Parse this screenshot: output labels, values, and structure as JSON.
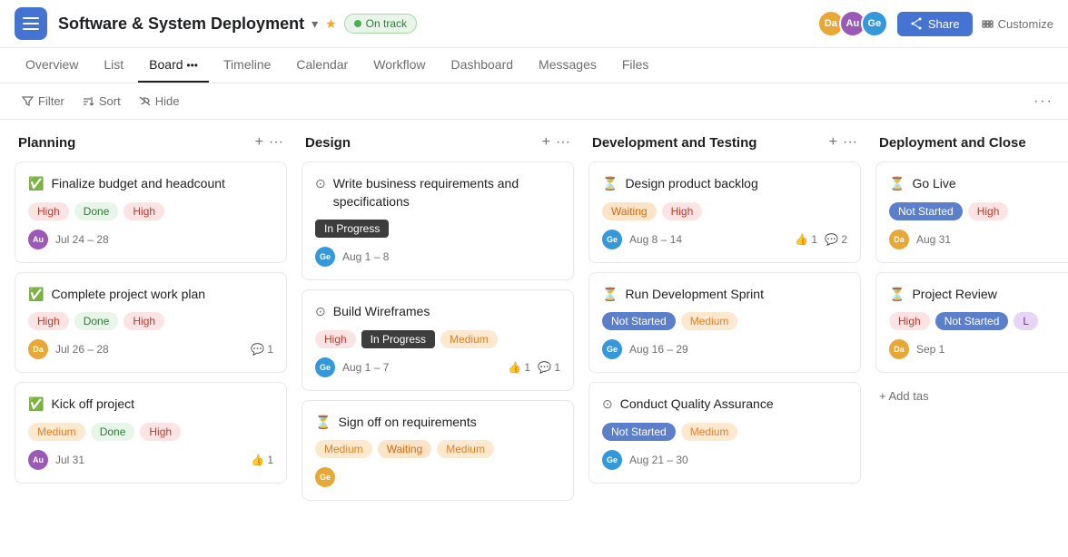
{
  "app": {
    "menu_label": "Menu",
    "project_title": "Software & System Deployment",
    "status": "On track",
    "share_label": "Share",
    "customize_label": "Customize"
  },
  "nav": {
    "items": [
      {
        "label": "Overview",
        "active": false
      },
      {
        "label": "List",
        "active": false
      },
      {
        "label": "Board",
        "active": true
      },
      {
        "label": "Timeline",
        "active": false
      },
      {
        "label": "Calendar",
        "active": false
      },
      {
        "label": "Workflow",
        "active": false
      },
      {
        "label": "Dashboard",
        "active": false
      },
      {
        "label": "Messages",
        "active": false
      },
      {
        "label": "Files",
        "active": false
      }
    ]
  },
  "toolbar": {
    "filter_label": "Filter",
    "sort_label": "Sort",
    "hide_label": "Hide"
  },
  "avatars": [
    {
      "initials": "Da",
      "color": "#e8a838"
    },
    {
      "initials": "Au",
      "color": "#9b59b6"
    },
    {
      "initials": "Ge",
      "color": "#3498db"
    }
  ],
  "columns": [
    {
      "id": "planning",
      "title": "Planning",
      "cards": [
        {
          "id": "card-1",
          "icon": "green-check",
          "title": "Finalize budget and headcount",
          "tags": [
            {
              "label": "High",
              "type": "high"
            },
            {
              "label": "Done",
              "type": "done"
            },
            {
              "label": "High",
              "type": "high"
            }
          ],
          "avatar_initials": "Au",
          "avatar_color": "#9b59b6",
          "date": "Jul 24 – 28",
          "likes": null,
          "comments": null
        },
        {
          "id": "card-2",
          "icon": "green-check",
          "title": "Complete project work plan",
          "tags": [
            {
              "label": "High",
              "type": "high"
            },
            {
              "label": "Done",
              "type": "done"
            },
            {
              "label": "High",
              "type": "high"
            }
          ],
          "avatar_initials": "Da",
          "avatar_color": "#e8a838",
          "date": "Jul 26 – 28",
          "likes": null,
          "comments": "1"
        },
        {
          "id": "card-3",
          "icon": "green-check",
          "title": "Kick off project",
          "tags": [
            {
              "label": "Medium",
              "type": "medium"
            },
            {
              "label": "Done",
              "type": "done"
            },
            {
              "label": "High",
              "type": "high"
            }
          ],
          "avatar_initials": "Au",
          "avatar_color": "#9b59b6",
          "date": "Jul 31",
          "likes": "1",
          "comments": null
        }
      ]
    },
    {
      "id": "design",
      "title": "Design",
      "cards": [
        {
          "id": "card-4",
          "icon": "circle-check",
          "title": "Write business requirements and specifications",
          "tags": [
            {
              "label": "In Progress",
              "type": "in-progress"
            }
          ],
          "avatar_initials": "Ge",
          "avatar_color": "#3498db",
          "date": "Aug 1 – 8",
          "likes": null,
          "comments": null
        },
        {
          "id": "card-5",
          "icon": "circle-check",
          "title": "Build Wireframes",
          "tags": [
            {
              "label": "High",
              "type": "high"
            },
            {
              "label": "In Progress",
              "type": "in-progress"
            },
            {
              "label": "Medium",
              "type": "medium"
            }
          ],
          "avatar_initials": "Ge",
          "avatar_color": "#3498db",
          "date": "Aug 1 – 7",
          "likes": "1",
          "comments": "1"
        },
        {
          "id": "card-6",
          "icon": "hourglass",
          "title": "Sign off on requirements",
          "tags": [
            {
              "label": "Medium",
              "type": "medium"
            },
            {
              "label": "Waiting",
              "type": "waiting"
            },
            {
              "label": "Medium",
              "type": "medium"
            }
          ],
          "avatar_initials": "Ge",
          "avatar_color": "#e8a838",
          "date": null,
          "likes": null,
          "comments": null
        }
      ]
    },
    {
      "id": "dev-testing",
      "title": "Development and Testing",
      "cards": [
        {
          "id": "card-7",
          "icon": "hourglass",
          "title": "Design product backlog",
          "tags": [
            {
              "label": "Waiting",
              "type": "waiting"
            },
            {
              "label": "High",
              "type": "high"
            }
          ],
          "avatar_initials": "Ge",
          "avatar_color": "#3498db",
          "date": "Aug 8 – 14",
          "likes": "1",
          "comments": "2"
        },
        {
          "id": "card-8",
          "icon": "hourglass",
          "title": "Run Development Sprint",
          "tags": [
            {
              "label": "Not Started",
              "type": "not-started"
            },
            {
              "label": "Medium",
              "type": "medium"
            }
          ],
          "avatar_initials": "Ge",
          "avatar_color": "#3498db",
          "date": "Aug 16 – 29",
          "likes": null,
          "comments": null
        },
        {
          "id": "card-9",
          "icon": "circle-check",
          "title": "Conduct Quality Assurance",
          "tags": [
            {
              "label": "Not Started",
              "type": "not-started"
            },
            {
              "label": "Medium",
              "type": "medium"
            }
          ],
          "avatar_initials": "Ge",
          "avatar_color": "#3498db",
          "date": "Aug 21 – 30",
          "likes": null,
          "comments": null
        }
      ]
    },
    {
      "id": "deployment",
      "title": "Deployment and Close",
      "cards": [
        {
          "id": "card-10",
          "icon": "hourglass",
          "title": "Go Live",
          "tags": [
            {
              "label": "Not Started",
              "type": "not-started"
            },
            {
              "label": "High",
              "type": "high"
            }
          ],
          "avatar_initials": "Da",
          "avatar_color": "#e8a838",
          "date": "Aug 31",
          "likes": null,
          "comments": null
        },
        {
          "id": "card-11",
          "icon": "hourglass",
          "title": "Project Review",
          "tags": [
            {
              "label": "High",
              "type": "high"
            },
            {
              "label": "Not Started",
              "type": "not-started"
            },
            {
              "label": "Low",
              "type": "low"
            }
          ],
          "avatar_initials": "Da",
          "avatar_color": "#e8a838",
          "date": "Sep 1",
          "likes": null,
          "comments": null
        }
      ],
      "add_task_label": "+ Add tas"
    }
  ]
}
